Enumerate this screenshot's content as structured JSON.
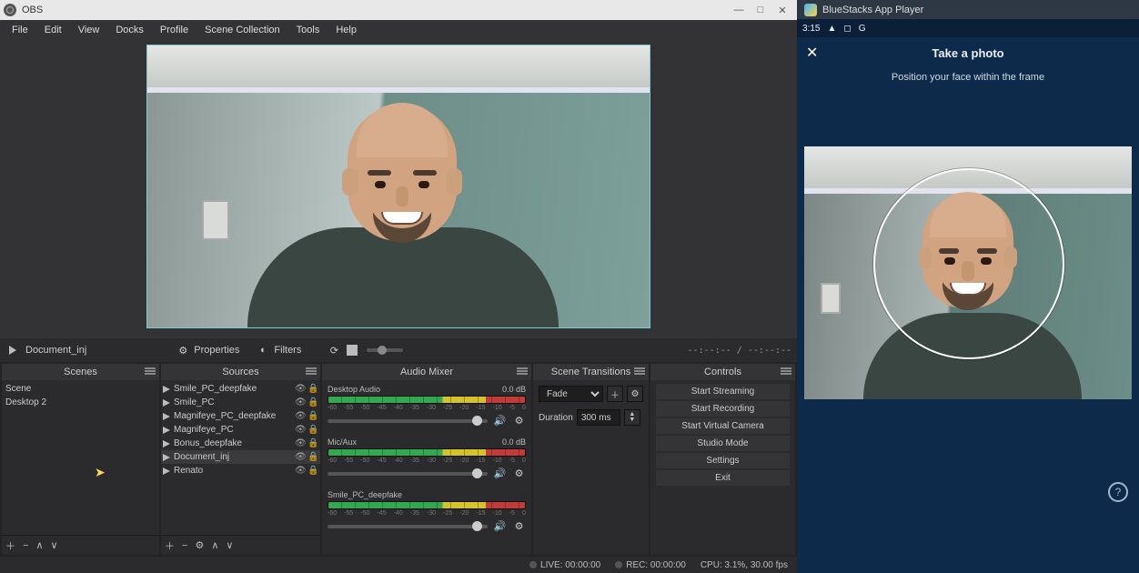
{
  "obs": {
    "window_title": "OBS",
    "window_buttons": {
      "min": "—",
      "max": "□",
      "close": "✕"
    },
    "menu": [
      "File",
      "Edit",
      "View",
      "Docks",
      "Profile",
      "Scene Collection",
      "Tools",
      "Help"
    ],
    "toolbar": {
      "selected_source": "Document_inj",
      "properties": "Properties",
      "filters": "Filters",
      "timecode": "--:--:-- / --:--:--"
    },
    "docks": {
      "scenes": {
        "title": "Scenes",
        "items": [
          "Scene",
          "Desktop 2"
        ]
      },
      "sources": {
        "title": "Sources",
        "items": [
          "Smile_PC_deepfake",
          "Smile_PC",
          "Magnifeye_PC_deepfake",
          "Magnifeye_PC",
          "Bonus_deepfake",
          "Document_inj",
          "Renato"
        ],
        "selected": "Document_inj"
      },
      "mixer": {
        "title": "Audio Mixer",
        "ticks": [
          "-60",
          "-55",
          "-50",
          "-45",
          "-40",
          "-35",
          "-30",
          "-25",
          "-20",
          "-15",
          "-10",
          "-5",
          "0"
        ],
        "channels": [
          {
            "name": "Desktop Audio",
            "level": "0.0 dB"
          },
          {
            "name": "Mic/Aux",
            "level": "0.0 dB"
          },
          {
            "name": "Smile_PC_deepfake",
            "level": ""
          }
        ]
      },
      "transitions": {
        "title": "Scene Transitions",
        "type": "Fade",
        "duration_label": "Duration",
        "duration": "300 ms"
      },
      "controls": {
        "title": "Controls",
        "buttons": [
          "Start Streaming",
          "Start Recording",
          "Start Virtual Camera",
          "Studio Mode",
          "Settings",
          "Exit"
        ]
      }
    },
    "status": {
      "live": "LIVE: 00:00:00",
      "rec": "REC: 00:00:00",
      "cpu": "CPU: 3.1%, 30.00 fps"
    }
  },
  "bluestacks": {
    "title": "BlueStacks App Player",
    "clock": "3:15",
    "header_title": "Take a photo",
    "subtitle": "Position your face within the frame",
    "help": "?"
  }
}
